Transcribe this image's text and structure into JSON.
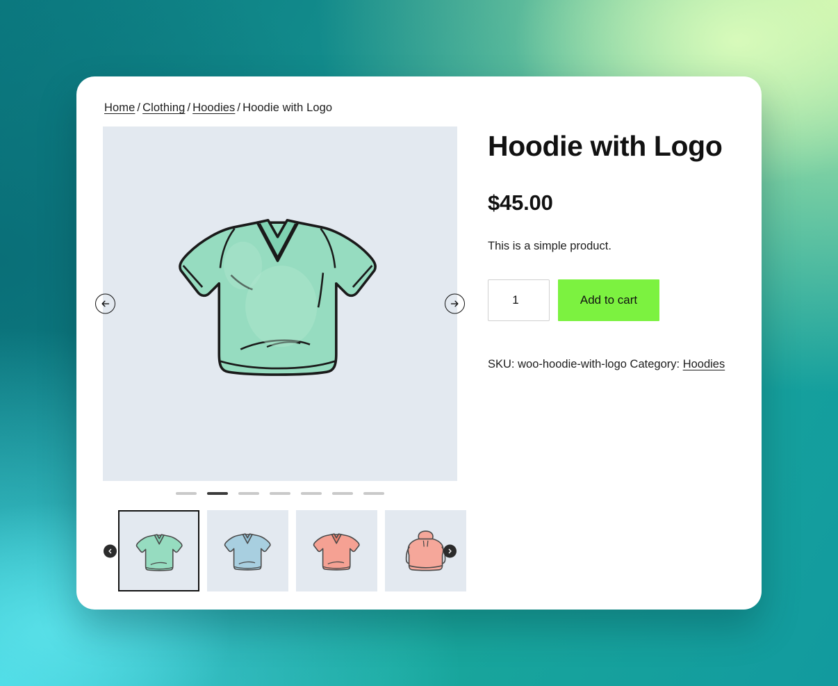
{
  "theme": {
    "card_bg": "#ffffff",
    "image_bg": "#e3e9f0",
    "accent_button": "#7cf240",
    "text": "#1c1c1c",
    "backdrop_teal": "#0b7a80",
    "backdrop_green": "#c8f2a8",
    "backdrop_cyan": "#4ad9e4"
  },
  "breadcrumb": {
    "items": [
      {
        "label": "Home",
        "is_link": true
      },
      {
        "label": "Clothing",
        "is_link": true
      },
      {
        "label": "Hoodies",
        "is_link": true
      },
      {
        "label": "Hoodie with Logo",
        "is_link": false
      }
    ],
    "separator": "/"
  },
  "gallery": {
    "prev_arrow_icon": "arrow-left-icon",
    "next_arrow_icon": "arrow-right-icon",
    "thumb_prev_icon": "chevron-left-icon",
    "thumb_next_icon": "chevron-right-icon",
    "dots": [
      {
        "active": false
      },
      {
        "active": true
      },
      {
        "active": false
      },
      {
        "active": false
      },
      {
        "active": false
      },
      {
        "active": false
      },
      {
        "active": false
      }
    ],
    "main_image": {
      "alt": "Mint green v-neck t-shirt illustration",
      "garment": "tee",
      "color": "#96dcc0"
    },
    "thumbnails": [
      {
        "alt": "Mint green v-neck t-shirt",
        "garment": "tee",
        "color": "#96dcc0",
        "selected": true
      },
      {
        "alt": "Light blue v-neck t-shirt",
        "garment": "tee",
        "color": "#a8cfe0",
        "selected": false
      },
      {
        "alt": "Salmon v-neck t-shirt",
        "garment": "tee",
        "color": "#f5a193",
        "selected": false
      },
      {
        "alt": "Salmon pullover hoodie",
        "garment": "hoodie",
        "color": "#f5a79a",
        "selected": false
      }
    ]
  },
  "product": {
    "title": "Hoodie with Logo",
    "price": "$45.00",
    "short_description": "This is a simple product.",
    "quantity_value": "1",
    "quantity_placeholder": "1",
    "add_to_cart_label": "Add to cart",
    "sku_label": "SKU:",
    "sku_value": "woo-hoodie-with-logo",
    "category_label": "Category:",
    "category_value": "Hoodies"
  }
}
